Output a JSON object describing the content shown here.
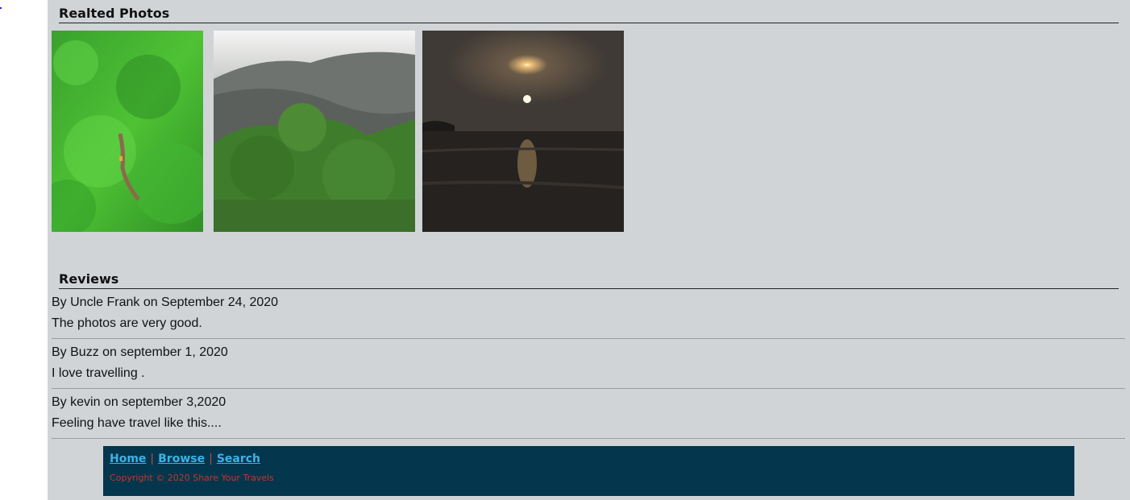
{
  "related": {
    "heading": "Realted Photos",
    "photos": [
      {
        "name": "green-forest-road-photo"
      },
      {
        "name": "misty-mountain-forest-photo"
      },
      {
        "name": "sunset-sea-photo"
      }
    ]
  },
  "reviews": {
    "heading": "Reviews",
    "items": [
      {
        "by": "By Uncle Frank on September 24, 2020",
        "text": "The photos are very good."
      },
      {
        "by": "By Buzz on september 1, 2020",
        "text": "I love travelling ."
      },
      {
        "by": "By kevin on september 3,2020",
        "text": "Feeling have travel like this...."
      }
    ]
  },
  "footer": {
    "links": {
      "home": "Home",
      "browse": "Browse",
      "search": "Search"
    },
    "separator": "|",
    "copyright": "Copyright © 2020 Share Your Travels"
  }
}
